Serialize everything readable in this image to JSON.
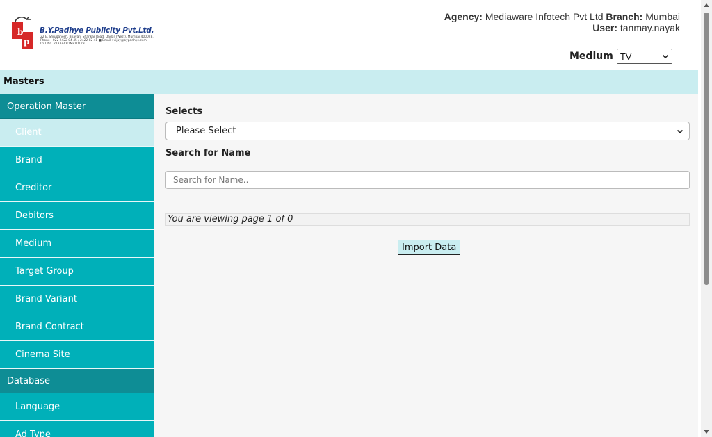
{
  "header": {
    "logo": {
      "company": "B.Y.Padhye Publicity Pvt.Ltd.",
      "address_lines": [
        "22 E, Shruganesh, Bhavani Shankar Road, Dadar (West), Mumbai 400028.",
        "Phone : 022 2422 04 45 / 2422 02 41  ■  Email : vijay@bypadhye.com",
        "GST No. 27AAACB1MF1D1Z3"
      ]
    },
    "agency_label": "Agency:",
    "agency_value": "Mediaware Infotech Pvt Ltd",
    "branch_label": "Branch:",
    "branch_value": "Mumbai",
    "user_label": "User:",
    "user_value": "tanmay.nayak",
    "medium_label": "Medium",
    "medium_value": "TV"
  },
  "masters_bar": {
    "title": "Masters"
  },
  "sidebar": {
    "section1": "Operation Master",
    "items1": [
      {
        "label": "Client",
        "active": true
      },
      {
        "label": "Brand"
      },
      {
        "label": "Creditor"
      },
      {
        "label": "Debitors"
      },
      {
        "label": "Medium"
      },
      {
        "label": "Target Group"
      },
      {
        "label": "Brand Variant"
      },
      {
        "label": "Brand Contract"
      },
      {
        "label": "Cinema Site"
      }
    ],
    "section2": "Database",
    "items2": [
      {
        "label": "Language"
      },
      {
        "label": "Ad Type"
      }
    ]
  },
  "main": {
    "selects_label": "Selects",
    "select_value": "Please Select",
    "search_label": "Search for Name",
    "search_placeholder": "Search for Name..",
    "pager_text": "You are viewing page 1 of 0",
    "import_button": "Import Data"
  },
  "colors": {
    "teal": "#00b0b9",
    "teal_dark": "#0e8d95",
    "light_cyan": "#c9edf0",
    "logo_red": "#d62828",
    "logo_blue": "#1f3e8c"
  }
}
